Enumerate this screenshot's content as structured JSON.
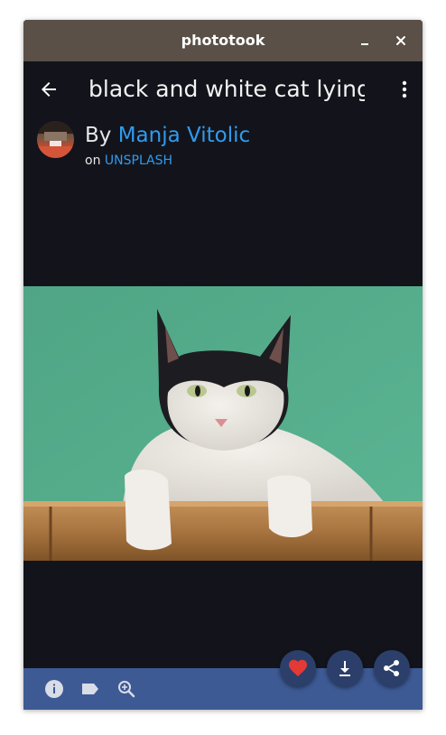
{
  "window": {
    "title": "phototook"
  },
  "appbar": {
    "title": "black and white cat lying",
    "back_icon": "arrow-back-icon",
    "menu_icon": "more-vert-icon"
  },
  "author": {
    "prefix": "By ",
    "name": "Manja Vitolic",
    "source_prefix": "on ",
    "source": "UNSPLASH"
  },
  "bottom_bar": {
    "icons": [
      "info-icon",
      "tag-icon",
      "zoom-in-icon"
    ]
  },
  "fabs": {
    "icons": [
      "heart-icon",
      "download-icon",
      "share-icon"
    ]
  },
  "colors": {
    "accent": "#2f9bf0",
    "titlebar": "#5a5047",
    "background": "#13141b",
    "bottom_bar": "#3d5a94",
    "fab": "#2c3f6a",
    "favorite": "#e53935"
  }
}
